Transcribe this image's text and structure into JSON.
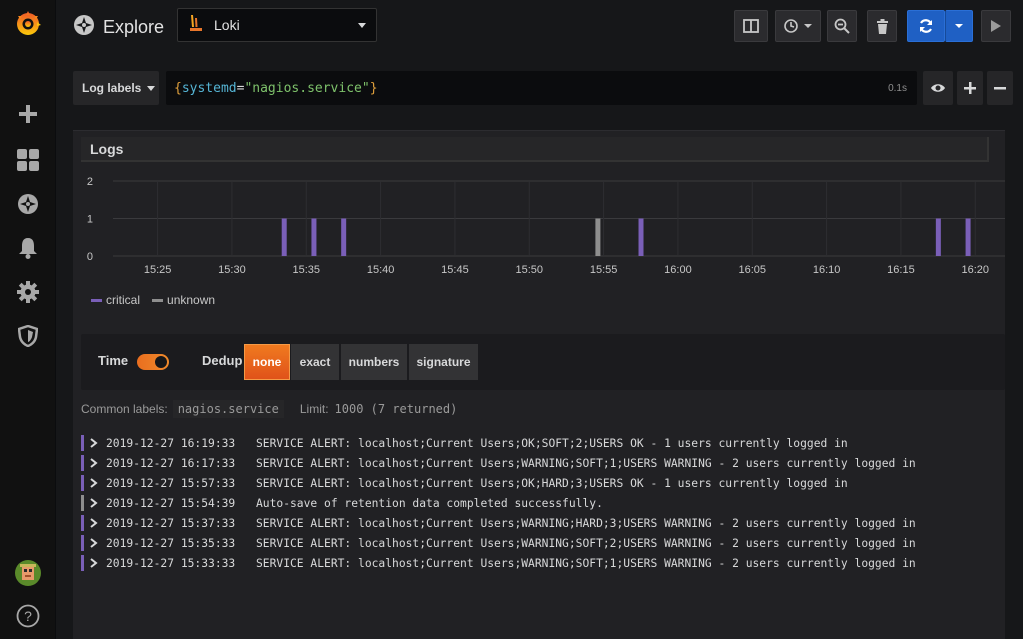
{
  "app": {
    "title": "Explore"
  },
  "datasource": {
    "name": "Loki"
  },
  "query": {
    "log_labels_label": "Log labels",
    "open_brace": "{",
    "key": "systemd",
    "op": "=",
    "value": "\"nagios.service\"",
    "close_brace": "}",
    "time": "0.1s"
  },
  "panel": {
    "title": "Logs"
  },
  "chart_data": {
    "type": "bar",
    "y_ticks": [
      "2",
      "1",
      "0"
    ],
    "ylim": [
      0,
      2
    ],
    "x_ticks": [
      "15:25",
      "15:30",
      "15:35",
      "15:40",
      "15:45",
      "15:50",
      "15:55",
      "16:00",
      "16:05",
      "16:10",
      "16:15",
      "16:20"
    ],
    "series": [
      {
        "name": "critical",
        "color": "#7a5fb8",
        "points": [
          {
            "x": "15:33:33",
            "y": 1
          },
          {
            "x": "15:35:33",
            "y": 1
          },
          {
            "x": "15:37:33",
            "y": 1
          },
          {
            "x": "15:57:33",
            "y": 1
          },
          {
            "x": "16:17:33",
            "y": 1
          },
          {
            "x": "16:19:33",
            "y": 1
          }
        ]
      },
      {
        "name": "unknown",
        "color": "#8e8e8e",
        "points": [
          {
            "x": "15:54:39",
            "y": 1
          }
        ]
      }
    ]
  },
  "controls": {
    "time_label": "Time",
    "dedup_label": "Dedup",
    "dedup_options": [
      "none",
      "exact",
      "numbers",
      "signature"
    ],
    "dedup_selected": "none"
  },
  "meta": {
    "common_labels_label": "Common labels:",
    "common_labels_value": "nagios.service",
    "limit_label": "Limit:",
    "limit_value": "1000 (7 returned)"
  },
  "logs": [
    {
      "level": "critical",
      "color": "#7a5fb8",
      "ts": "2019-12-27 16:19:33",
      "msg": "SERVICE ALERT: localhost;Current Users;OK;SOFT;2;USERS OK - 1 users currently logged in"
    },
    {
      "level": "critical",
      "color": "#7a5fb8",
      "ts": "2019-12-27 16:17:33",
      "msg": "SERVICE ALERT: localhost;Current Users;WARNING;SOFT;1;USERS WARNING - 2 users currently logged in"
    },
    {
      "level": "critical",
      "color": "#7a5fb8",
      "ts": "2019-12-27 15:57:33",
      "msg": "SERVICE ALERT: localhost;Current Users;OK;HARD;3;USERS OK - 1 users currently logged in"
    },
    {
      "level": "unknown",
      "color": "#8e8e8e",
      "ts": "2019-12-27 15:54:39",
      "msg": "Auto-save of retention data completed successfully."
    },
    {
      "level": "critical",
      "color": "#7a5fb8",
      "ts": "2019-12-27 15:37:33",
      "msg": "SERVICE ALERT: localhost;Current Users;WARNING;HARD;3;USERS WARNING - 2 users currently logged in"
    },
    {
      "level": "critical",
      "color": "#7a5fb8",
      "ts": "2019-12-27 15:35:33",
      "msg": "SERVICE ALERT: localhost;Current Users;WARNING;SOFT;2;USERS WARNING - 2 users currently logged in"
    },
    {
      "level": "critical",
      "color": "#7a5fb8",
      "ts": "2019-12-27 15:33:33",
      "msg": "SERVICE ALERT: localhost;Current Users;WARNING;SOFT;1;USERS WARNING - 2 users currently logged in"
    }
  ],
  "icons": {
    "sidebar": [
      "grafana-logo-icon",
      "plus-icon",
      "dashboards-icon",
      "explore-icon",
      "bell-icon",
      "gear-icon",
      "shield-icon",
      "avatar",
      "help-icon"
    ],
    "toolbar": [
      "split-icon",
      "clock-icon",
      "zoom-out-icon",
      "trash-icon",
      "refresh-icon",
      "caret-down-icon",
      "play-icon"
    ]
  },
  "colors": {
    "accent": "#eb7b18",
    "critical": "#7a5fb8",
    "unknown": "#8e8e8e",
    "run_button": "#1f60c4"
  }
}
